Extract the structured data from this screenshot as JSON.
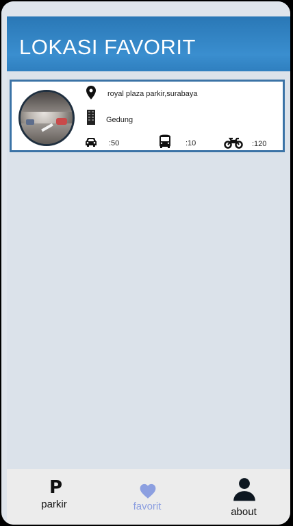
{
  "header": {
    "title": "LOKASI FAVORIT"
  },
  "favorites": [
    {
      "location": "royal plaza parkir,surabaya",
      "type": "Gedung",
      "car_slots": ":50",
      "bus_slots": ":10",
      "motor_slots": ":120",
      "icons": {
        "location": "map-pin-icon",
        "type": "building-icon",
        "car": "car-icon",
        "bus": "bus-icon",
        "motor": "motorcycle-icon"
      }
    }
  ],
  "bottom_nav": {
    "items": [
      {
        "label": "parkir",
        "icon": "P",
        "active": false
      },
      {
        "label": "favorit",
        "icon": "heart-icon",
        "active": true
      },
      {
        "label": "about",
        "icon": "person-icon",
        "active": false
      }
    ],
    "active_color": "#8c9fe0",
    "inactive_color": "#111111"
  },
  "colors": {
    "header": "#2f7fbf",
    "card_border": "#3b73a6",
    "background": "#dbe2ea"
  }
}
